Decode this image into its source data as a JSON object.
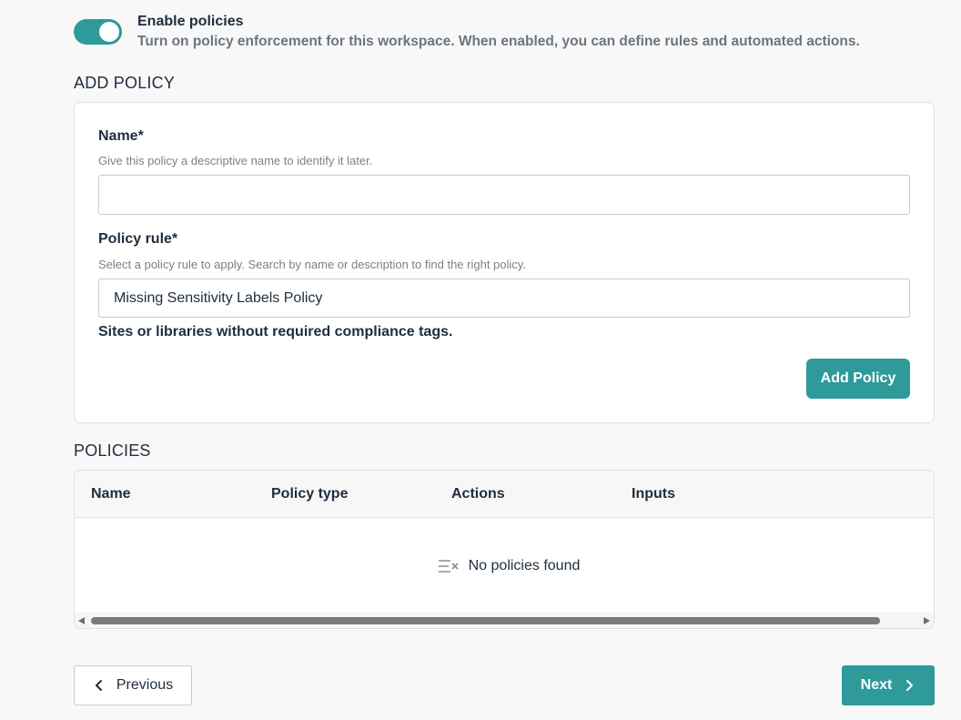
{
  "toggle": {
    "title": "Enable policies",
    "description": "Turn on policy enforcement for this workspace. When enabled, you can define rules and automated actions.",
    "enabled": true
  },
  "add_policy": {
    "section_title": "ADD POLICY",
    "name_label": "Name*",
    "name_help": "Give this policy a descriptive name to identify it later.",
    "name_value": "",
    "rule_label": "Policy rule*",
    "rule_help": "Select a policy rule to apply. Search by name or description to find the right policy.",
    "rule_value": "Missing Sensitivity Labels Policy",
    "rule_description": "Sites or libraries without required compliance tags.",
    "add_button": "Add Policy"
  },
  "policies": {
    "section_title": "POLICIES",
    "columns": [
      "Name",
      "Policy type",
      "Actions",
      "Inputs"
    ],
    "rows": [],
    "empty_text": "No policies found"
  },
  "footer": {
    "previous_label": "Previous",
    "next_label": "Next"
  },
  "colors": {
    "accent": "#2e9a9a",
    "text": "#1f2d3d",
    "muted": "#6b7580"
  },
  "icons": {
    "empty": "clear-list-icon",
    "previous": "chevron-left-icon",
    "next": "chevron-right-icon"
  }
}
